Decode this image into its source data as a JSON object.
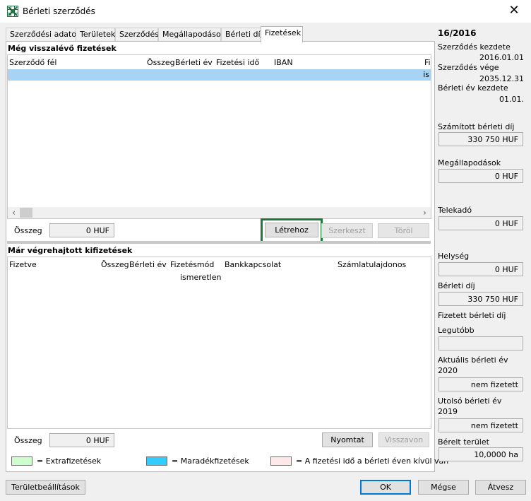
{
  "window": {
    "title": "Bérleti szerződés",
    "app_icon": "excel-like-grid-icon",
    "close_glyph": "✕"
  },
  "tabs": [
    {
      "label": "Szerződési adatok",
      "active": false
    },
    {
      "label": "Területek",
      "active": false
    },
    {
      "label": "Szerződés",
      "active": false
    },
    {
      "label": "Megállapodások",
      "active": false
    },
    {
      "label": "Bérleti díj",
      "active": false
    },
    {
      "label": "Fizetések",
      "active": true
    }
  ],
  "pending": {
    "title": "Még visszalévő fizetések",
    "columns": [
      "Szerződő fél",
      "Összeg",
      "Bérleti év",
      "Fizetési idő",
      "IBAN",
      "Fi"
    ],
    "selected_row_partial_text": "is",
    "sum_label": "Összeg",
    "sum_value": "0 HUF",
    "create_button": "Létrehoz",
    "edit_button": "Szerkeszt",
    "delete_button": "Töröl"
  },
  "completed": {
    "title": "Már végrehajtott kifizetések",
    "columns": [
      "Fizetve",
      "Összeg",
      "Bérleti év",
      "Fizetésmód",
      "Bankkapcsolat",
      "Számlatulajdonos"
    ],
    "row_partial": "ismeretlen",
    "sum_label": "Összeg",
    "sum_value": "0 HUF",
    "print_button": "Nyomtat",
    "revoke_button": "Visszavon"
  },
  "legend": [
    {
      "color": "#ccffcc",
      "label": "= Extrafizetések"
    },
    {
      "color": "#33ccff",
      "label": "= Maradékfizetések"
    },
    {
      "color": "#ffe8e8",
      "label": "= A fizetési idő a bérleti éven kívül van"
    }
  ],
  "sidebar": {
    "contract_no": "16/2016",
    "start_label": "Szerződés kezdete",
    "start_value": "2016.01.01",
    "end_label": "Szerződés vége",
    "end_value": "2035.12.31",
    "year_start_label": "Bérleti év kezdete",
    "year_start_value": "01.01.",
    "calc_fee_label": "Számított bérleti díj",
    "calc_fee_value": "330 750 HUF",
    "agreements_label": "Megállapodások",
    "agreements_value": "0 HUF",
    "land_tax_label": "Telekadó",
    "land_tax_value": "0 HUF",
    "locality_label": "Helység",
    "locality_value": "0 HUF",
    "rent_label": "Bérleti díj",
    "rent_value": "330 750 HUF",
    "paid_rent_label": "Fizetett bérleti díj",
    "latest_label": "Legutóbb",
    "latest_value": "",
    "current_year_label": "Aktuális bérleti év",
    "current_year": "2020",
    "current_year_value": "nem fizetett",
    "last_year_label": "Utolsó bérleti év",
    "last_year": "2019",
    "last_year_value": "nem fizetett",
    "area_label": "Bérelt terület",
    "area_value": "10,0000 ha"
  },
  "footer": {
    "settings_button": "Területbeállítások",
    "ok_button": "OK",
    "cancel_button": "Mégse",
    "apply_button": "Átvesz"
  },
  "colors": {
    "selection": "#a7d3f5",
    "highlight": "#1e7a3a",
    "default_button_border": "#0078d7"
  }
}
